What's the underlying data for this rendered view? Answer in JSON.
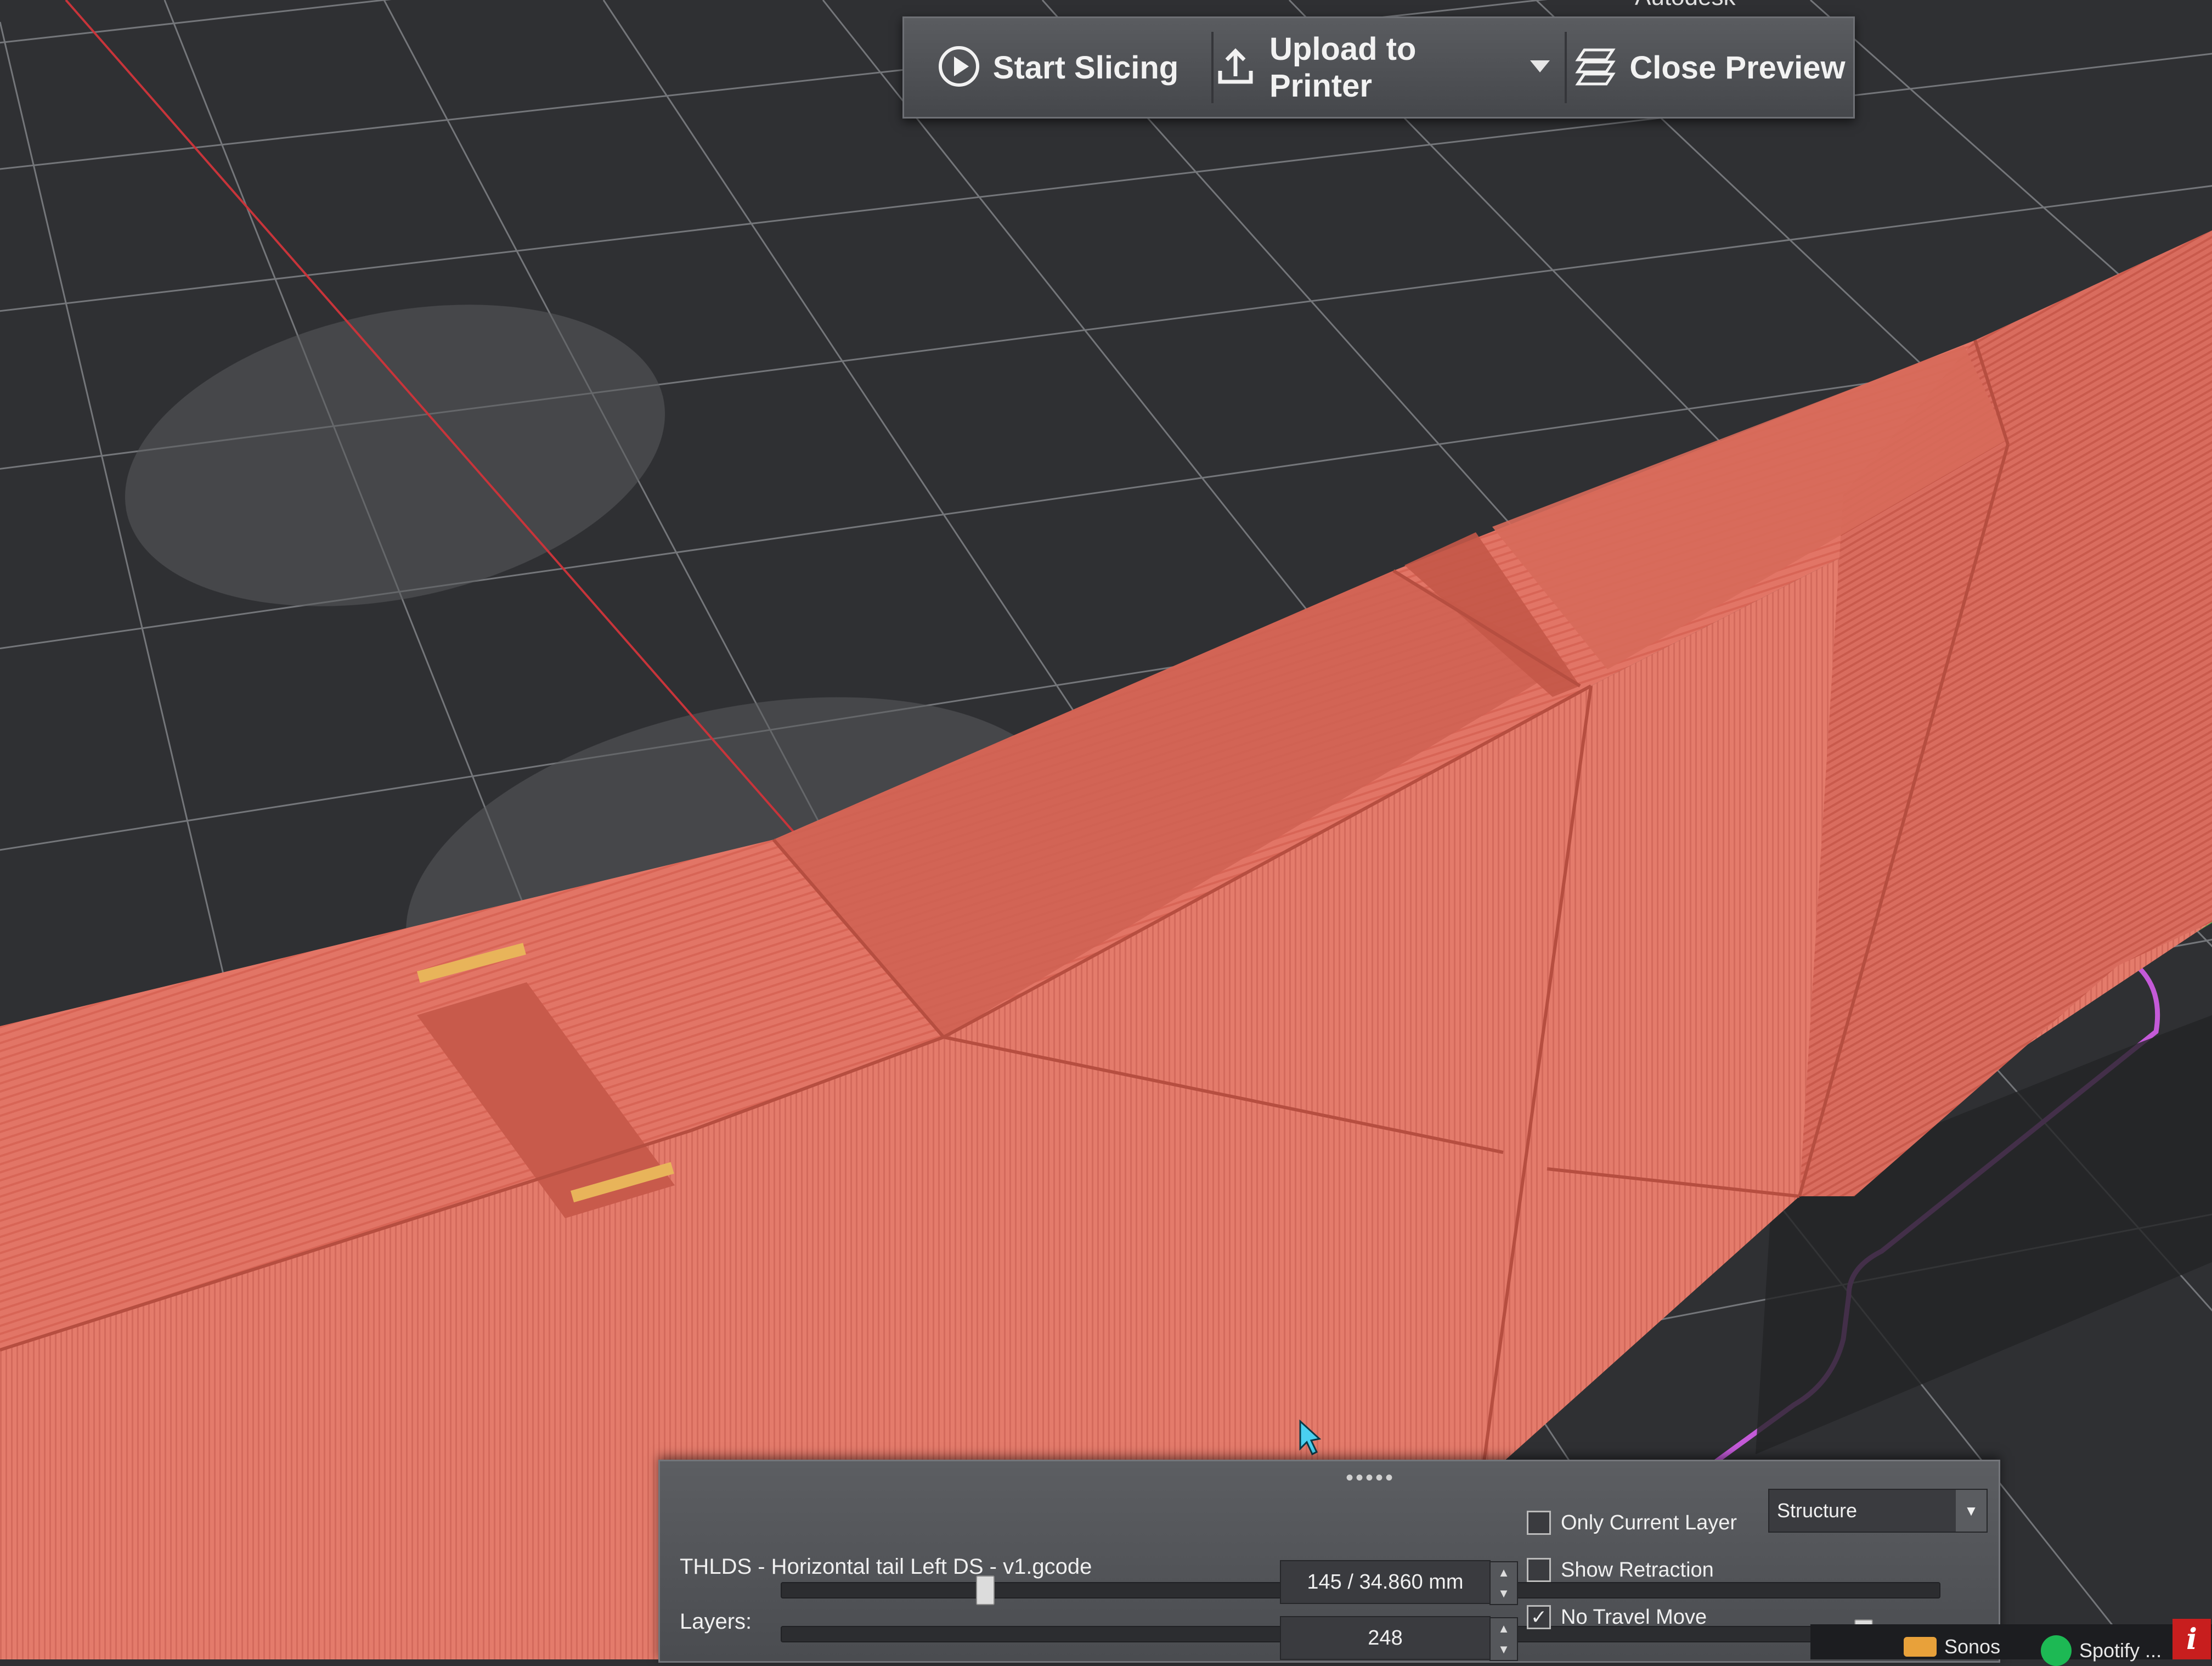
{
  "toolbar": {
    "start_slicing": "Start Slicing",
    "upload_to_printer": "Upload to Printer",
    "close_preview": "Close Preview"
  },
  "partial_top_text": "Autodesk",
  "preview_panel": {
    "filename": "THLDS - Horizontal tail Left DS - v1.gcode",
    "layers_label": "Layers:",
    "layer_height_value": "145 / 34.860 mm",
    "layer_count_value": "248",
    "slider_position_fraction": 0.17,
    "slider2_position_fraction": 0.94,
    "options": [
      {
        "label": "Only Current Layer",
        "checked": false
      },
      {
        "label": "Show Retraction",
        "checked": false
      },
      {
        "label": "No Travel Move",
        "checked": true
      }
    ],
    "view_mode": "Structure"
  },
  "taskbar": {
    "items": [
      "Sonos",
      "Spotify ..."
    ]
  },
  "colors": {
    "model": "#e27364",
    "grid_bg": "#2f3033",
    "toolpath_purple": "#c45ad8",
    "accent_yellow": "#e8b45a"
  }
}
